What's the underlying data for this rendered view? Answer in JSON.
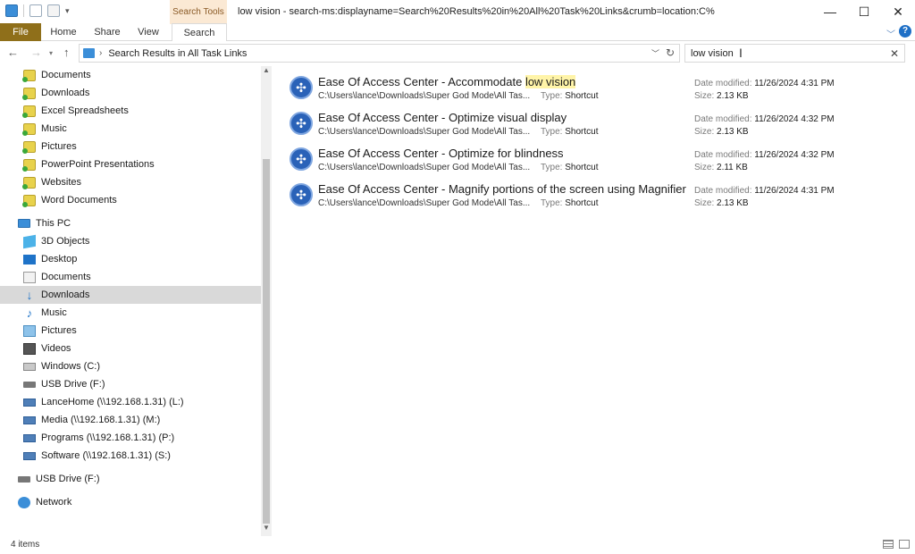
{
  "window": {
    "title": "low vision - search-ms:displayname=Search%20Results%20in%20All%20Task%20Links&crumb=location:C%",
    "context_tab": "Search Tools",
    "controls": [
      "—",
      "☐",
      "✕"
    ]
  },
  "ribbon": {
    "tabs": [
      "File",
      "Home",
      "Share",
      "View",
      "Search"
    ],
    "help": "?"
  },
  "address": {
    "path": "Search Results in All Task Links",
    "search_value": "low vision"
  },
  "navigation": {
    "libraries": [
      "Documents",
      "Downloads",
      "Excel Spreadsheets",
      "Music",
      "Pictures",
      "PowerPoint Presentations",
      "Websites",
      "Word Documents"
    ],
    "this_pc": "This PC",
    "pc_items": [
      {
        "label": "3D Objects",
        "icon": "3d-objects-icon"
      },
      {
        "label": "Desktop",
        "icon": "desktop-icon"
      },
      {
        "label": "Documents",
        "icon": "documents-icon"
      },
      {
        "label": "Downloads",
        "icon": "downloads-icon",
        "selected": true
      },
      {
        "label": "Music",
        "icon": "music-icon"
      },
      {
        "label": "Pictures",
        "icon": "pictures-icon"
      },
      {
        "label": "Videos",
        "icon": "videos-icon"
      },
      {
        "label": "Windows (C:)",
        "icon": "drive-icon"
      },
      {
        "label": "USB Drive (F:)",
        "icon": "usb-drive-icon"
      },
      {
        "label": "LanceHome (\\\\192.168.1.31) (L:)",
        "icon": "network-drive-icon"
      },
      {
        "label": "Media (\\\\192.168.1.31) (M:)",
        "icon": "network-drive-icon"
      },
      {
        "label": "Programs (\\\\192.168.1.31) (P:)",
        "icon": "network-drive-icon"
      },
      {
        "label": "Software (\\\\192.168.1.31) (S:)",
        "icon": "network-drive-icon"
      }
    ],
    "usb_drive": "USB Drive (F:)",
    "network": "Network"
  },
  "results": [
    {
      "name_prefix": "Ease Of Access Center - Accommodate ",
      "name_highlight": "low vision",
      "path": "C:\\Users\\lance\\Downloads\\Super God Mode\\All Tas...",
      "type_label": "Type:",
      "type": "Shortcut",
      "date_label": "Date modified:",
      "date": "11/26/2024 4:31 PM",
      "size_label": "Size:",
      "size": "2.13 KB"
    },
    {
      "name_prefix": "Ease Of Access Center - Optimize visual display",
      "name_highlight": "",
      "path": "C:\\Users\\lance\\Downloads\\Super God Mode\\All Tas...",
      "type_label": "Type:",
      "type": "Shortcut",
      "date_label": "Date modified:",
      "date": "11/26/2024 4:32 PM",
      "size_label": "Size:",
      "size": "2.13 KB"
    },
    {
      "name_prefix": "Ease Of Access Center - Optimize for blindness",
      "name_highlight": "",
      "path": "C:\\Users\\lance\\Downloads\\Super God Mode\\All Tas...",
      "type_label": "Type:",
      "type": "Shortcut",
      "date_label": "Date modified:",
      "date": "11/26/2024 4:32 PM",
      "size_label": "Size:",
      "size": "2.11 KB"
    },
    {
      "name_prefix": "Ease Of Access Center - Magnify portions of the screen using Magnifier",
      "name_highlight": "",
      "path": "C:\\Users\\lance\\Downloads\\Super God Mode\\All Tas...",
      "type_label": "Type:",
      "type": "Shortcut",
      "date_label": "Date modified:",
      "date": "11/26/2024 4:31 PM",
      "size_label": "Size:",
      "size": "2.13 KB"
    }
  ],
  "status": {
    "item_count": "4 items"
  }
}
